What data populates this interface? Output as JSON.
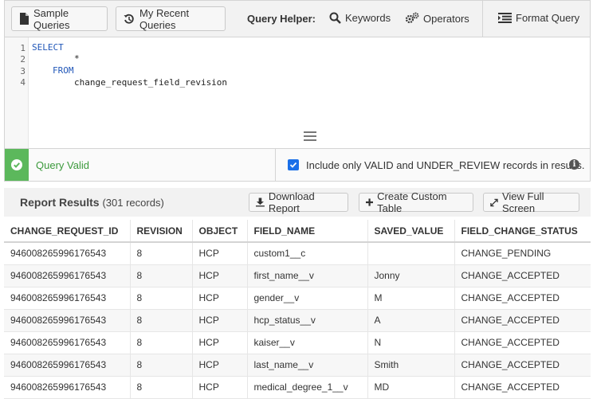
{
  "toolbar": {
    "sample_queries": "Sample Queries",
    "recent_queries": "My Recent Queries",
    "query_helper_label": "Query Helper:",
    "keywords": "Keywords",
    "operators": "Operators",
    "format_query": "Format Query"
  },
  "editor": {
    "lines": [
      {
        "number": "1",
        "text": "SELECT"
      },
      {
        "number": "2",
        "text": "*"
      },
      {
        "number": "3",
        "text": "FROM"
      },
      {
        "number": "4",
        "text": "change_request_field_revision"
      }
    ]
  },
  "status": {
    "valid_text": "Query Valid",
    "include_label": "Include only VALID and UNDER_REVIEW records in results.",
    "include_checked": true,
    "info_icon": "i"
  },
  "report": {
    "title": "Report Results",
    "count": "(301 records)",
    "download": "Download Report",
    "create_table": "Create Custom Table",
    "full_screen": "View Full Screen"
  },
  "table": {
    "columns": [
      "CHANGE_REQUEST_ID",
      "REVISION",
      "OBJECT",
      "FIELD_NAME",
      "SAVED_VALUE",
      "FIELD_CHANGE_STATUS"
    ],
    "rows": [
      [
        "946008265996176543",
        "8",
        "HCP",
        "custom1__c",
        "",
        "CHANGE_PENDING"
      ],
      [
        "946008265996176543",
        "8",
        "HCP",
        "first_name__v",
        "Jonny",
        "CHANGE_ACCEPTED"
      ],
      [
        "946008265996176543",
        "8",
        "HCP",
        "gender__v",
        "M",
        "CHANGE_ACCEPTED"
      ],
      [
        "946008265996176543",
        "8",
        "HCP",
        "hcp_status__v",
        "A",
        "CHANGE_ACCEPTED"
      ],
      [
        "946008265996176543",
        "8",
        "HCP",
        "kaiser__v",
        "N",
        "CHANGE_ACCEPTED"
      ],
      [
        "946008265996176543",
        "8",
        "HCP",
        "last_name__v",
        "Smith",
        "CHANGE_ACCEPTED"
      ],
      [
        "946008265996176543",
        "8",
        "HCP",
        "medical_degree_1__v",
        "MD",
        "CHANGE_ACCEPTED"
      ]
    ]
  },
  "colors": {
    "valid_green": "#5cb85c",
    "checkbox_blue": "#1a6fe8",
    "keyword_blue": "#2157b8"
  }
}
